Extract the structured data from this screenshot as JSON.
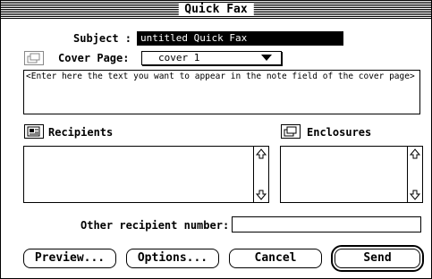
{
  "window": {
    "title": "Quick Fax"
  },
  "subject": {
    "label": "Subject :",
    "value": "untitled Quick Fax"
  },
  "cover_page": {
    "label": "Cover Page:",
    "selected": "cover 1"
  },
  "note": {
    "text": "<Enter here the text you want to appear in the note field of the cover page>"
  },
  "recipients": {
    "label": "Recipients",
    "items": []
  },
  "enclosures": {
    "label": "Enclosures",
    "items": []
  },
  "other_recipient": {
    "label": "Other recipient number:",
    "value": ""
  },
  "buttons": {
    "preview": "Preview...",
    "options": "Options...",
    "cancel": "Cancel",
    "send": "Send"
  },
  "icons": {
    "cover_page": "cover-page-icon",
    "recipients": "address-book-icon",
    "enclosures": "document-icon",
    "scroll_up": "scroll-up-arrow-icon",
    "scroll_down": "scroll-down-arrow-icon",
    "popup": "chevron-down-icon"
  }
}
